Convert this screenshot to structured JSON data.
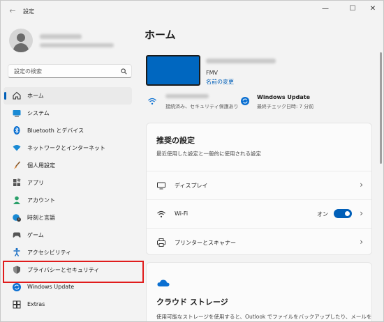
{
  "window": {
    "title": "設定",
    "back_icon": "back-arrow-icon",
    "controls": [
      "minimize-icon",
      "maximize-icon",
      "close-icon"
    ]
  },
  "profile": {
    "avatar_icon": "user-avatar-icon"
  },
  "search": {
    "placeholder": "設定の検索",
    "icon": "search-icon"
  },
  "sidebar": {
    "items": [
      {
        "label": "ホーム",
        "icon": "home-icon",
        "active": true
      },
      {
        "label": "システム",
        "icon": "monitor-icon"
      },
      {
        "label": "Bluetooth とデバイス",
        "icon": "bluetooth-icon"
      },
      {
        "label": "ネットワークとインターネット",
        "icon": "wifi-network-icon"
      },
      {
        "label": "個人用設定",
        "icon": "paint-brush-icon"
      },
      {
        "label": "アプリ",
        "icon": "apps-icon"
      },
      {
        "label": "アカウント",
        "icon": "account-icon"
      },
      {
        "label": "時刻と言語",
        "icon": "clock-globe-icon"
      },
      {
        "label": "ゲーム",
        "icon": "gamepad-icon"
      },
      {
        "label": "アクセシビリティ",
        "icon": "accessibility-icon"
      },
      {
        "label": "プライバシーとセキュリティ",
        "icon": "shield-icon",
        "highlighted": true
      },
      {
        "label": "Windows Update",
        "icon": "update-icon"
      },
      {
        "label": "Extras",
        "icon": "extras-grid-icon"
      }
    ],
    "accent_color": "#005fb8",
    "highlight_color": "#e01c1c"
  },
  "main": {
    "title": "ホーム",
    "device": {
      "model": "FMV",
      "rename_label": "名前の変更",
      "thumbnail_color": "#0067c0"
    },
    "network_status": {
      "subtitle": "接続済み、セキュリティ保護あり",
      "icon": "wifi-icon"
    },
    "update_status": {
      "title": "Windows Update",
      "subtitle": "最終チェック日時: 7 分前",
      "icon": "update-icon"
    },
    "recommended": {
      "title": "推奨の設定",
      "subtitle": "最近使用した設定と一般的に使用される設定",
      "rows": [
        {
          "label": "ディスプレイ",
          "icon": "display-icon"
        },
        {
          "label": "Wi-Fi",
          "icon": "wifi-icon",
          "toggle_label": "オン",
          "toggle_on": true
        },
        {
          "label": "プリンターとスキャナー",
          "icon": "printer-icon"
        }
      ]
    },
    "cloud": {
      "title": "クラウド ストレージ",
      "subtitle": "使用可能なストレージを使用すると、Outlook でファイルをバックアップしたり、メールを",
      "icon": "cloud-icon"
    }
  }
}
